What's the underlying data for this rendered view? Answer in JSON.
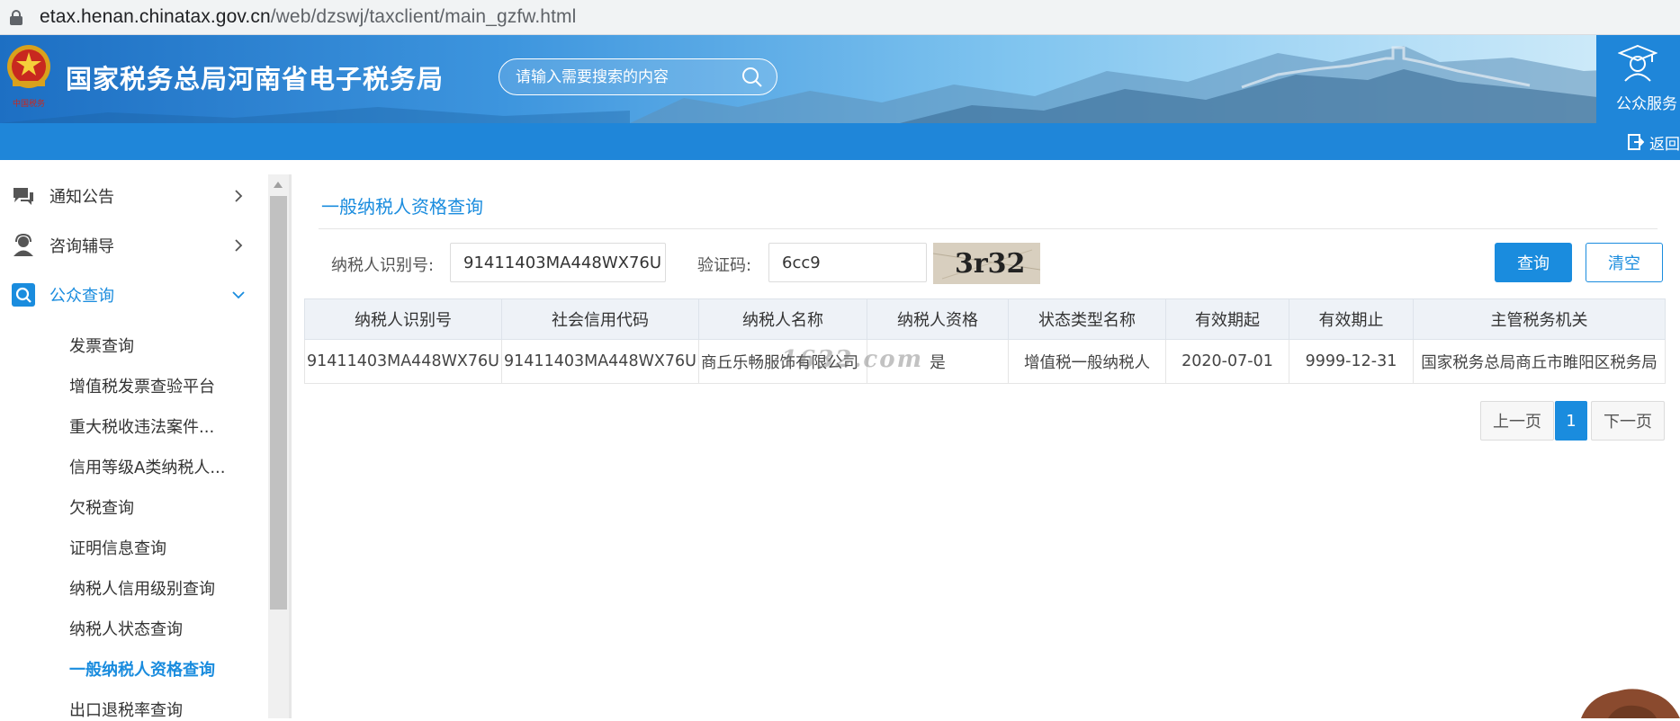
{
  "browser": {
    "url_host": "etax.henan.chinatax.gov.cn",
    "url_path": "/web/dzswj/taxclient/main_gzfw.html"
  },
  "header": {
    "site_title": "国家税务总局河南省电子税务局",
    "search_placeholder": "请输入需要搜索的内容",
    "public_service_label": "公众服务",
    "back_label": "返回"
  },
  "sidebar": {
    "menu": [
      {
        "label": "通知公告",
        "icon": "chat-bubble-icon"
      },
      {
        "label": "咨询辅导",
        "icon": "support-person-icon"
      },
      {
        "label": "公众查询",
        "icon": "search-icon"
      }
    ],
    "sub_items": [
      "发票查询",
      "增值税发票查验平台",
      "重大税收违法案件...",
      "信用等级A类纳税人...",
      "欠税查询",
      "证明信息查询",
      "纳税人信用级别查询",
      "纳税人状态查询",
      "一般纳税人资格查询",
      "出口退税率查询"
    ]
  },
  "main": {
    "page_title": "一般纳税人资格查询",
    "form": {
      "taxpayer_id_label": "纳税人识别号:",
      "taxpayer_id_value": "91411403MA448WX76U",
      "captcha_label": "验证码:",
      "captcha_value": "6cc9",
      "captcha_image_text": "3r32",
      "query_button": "查询",
      "clear_button": "清空"
    },
    "table": {
      "headers": [
        "纳税人识别号",
        "社会信用代码",
        "纳税人名称",
        "纳税人资格",
        "状态类型名称",
        "有效期起",
        "有效期止",
        "主管税务机关"
      ],
      "rows": [
        [
          "91411403MA448WX76U",
          "91411403MA448WX76U",
          "商丘乐畅服饰有限公司",
          "是",
          "增值税一般纳税人",
          "2020-07-01",
          "9999-12-31",
          "国家税务总局商丘市睢阳区税务局"
        ]
      ]
    },
    "watermark": "1632.com",
    "pagination": {
      "prev": "上一页",
      "current": "1",
      "next": "下一页"
    }
  },
  "colors": {
    "accent": "#1a8cde",
    "header_bar": "#1f86d9"
  }
}
